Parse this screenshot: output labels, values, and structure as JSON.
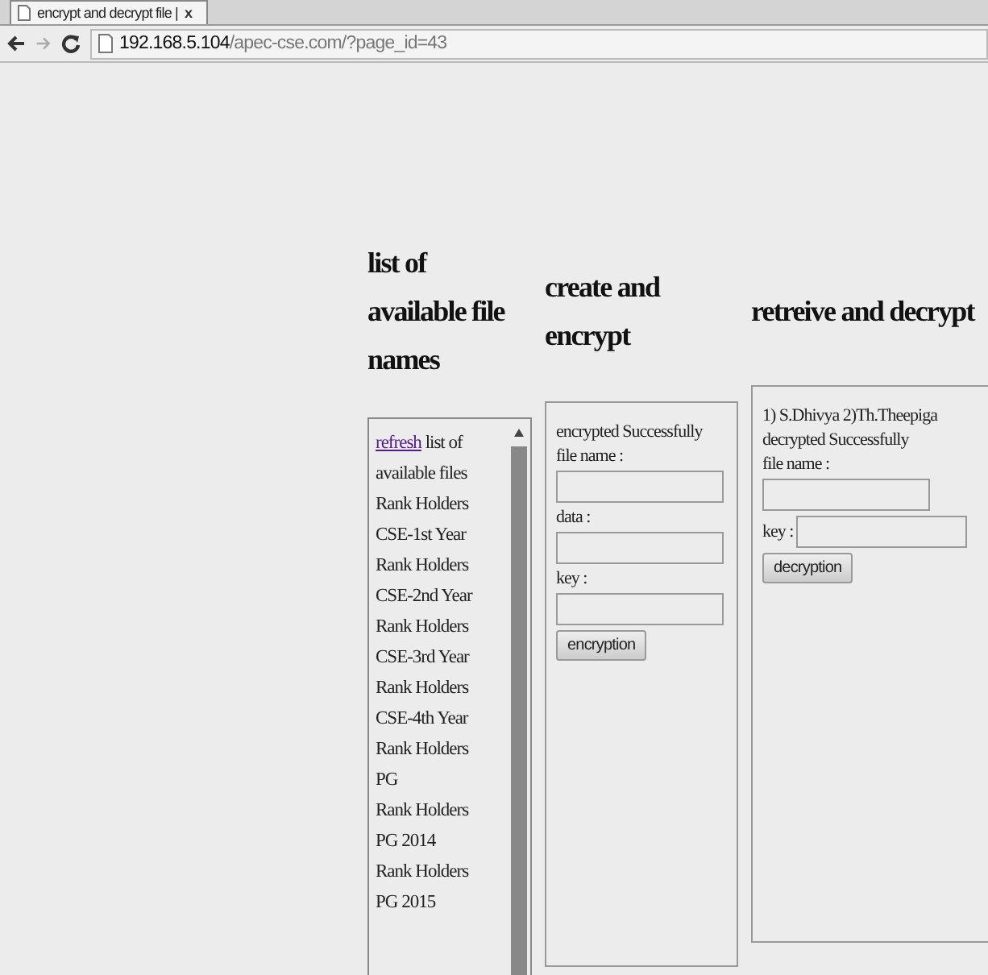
{
  "browser": {
    "tab": {
      "title": "encrypt and decrypt file |",
      "close": "x"
    },
    "address": {
      "host": "192.168.5.104",
      "path": "/apec-cse.com/?page_id=43"
    }
  },
  "file_list": {
    "heading": "list of available file names",
    "link": "refresh",
    "intro": " list of available files",
    "items": [
      "Rank Holders CSE-1st Year",
      "Rank Holders CSE-2nd Year",
      "Rank Holders CSE-3rd Year",
      "Rank Holders CSE-4th Year",
      "Rank Holders PG",
      "Rank Holders PG 2014",
      "Rank Holders PG 2015"
    ]
  },
  "encrypt": {
    "heading": "create and encrypt",
    "status": [
      "encrypted Successfully"
    ],
    "fields": [
      {
        "label": "file name :",
        "kind": "stacked"
      },
      {
        "label": "data :",
        "kind": "stacked"
      },
      {
        "label": "key :",
        "kind": "stacked"
      }
    ],
    "button": "encryption"
  },
  "decrypt": {
    "heading": "retreive and decrypt",
    "status": [
      "1) S.Dhivya 2)Th.Theepiga",
      "decrypted Successfully"
    ],
    "fields": [
      {
        "label": "file name :",
        "kind": "stacked"
      },
      {
        "label": "key :",
        "kind": "inline"
      }
    ],
    "button": "decryption"
  }
}
